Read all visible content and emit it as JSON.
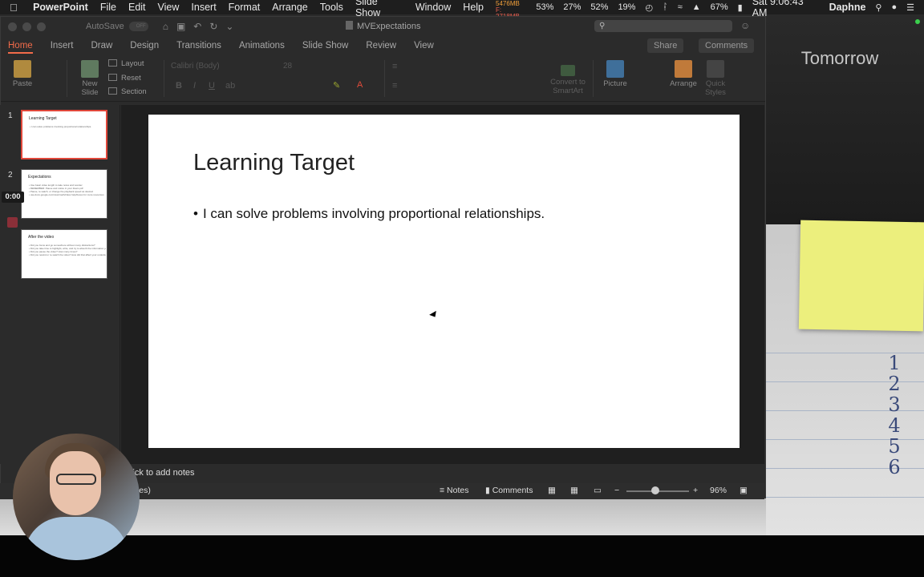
{
  "menubar": {
    "apple_icon": "apple-icon",
    "app_name": "PowerPoint",
    "items": [
      "File",
      "Edit",
      "View",
      "Insert",
      "Format",
      "Arrange",
      "Tools",
      "Slide Show",
      "Window",
      "Help"
    ],
    "memory_u": "U: 5476MB",
    "memory_f": "F: 2718MB",
    "stats": [
      "53%",
      "27%",
      "52%",
      "19%"
    ],
    "battery": "67%",
    "clock": "Sat 9:06:43 AM",
    "user": "Daphne"
  },
  "window": {
    "autosave_label": "AutoSave",
    "autosave_state": "OFF",
    "document_title": "MVExpectations"
  },
  "tabs": [
    "Home",
    "Insert",
    "Draw",
    "Design",
    "Transitions",
    "Animations",
    "Slide Show",
    "Review",
    "View"
  ],
  "share_label": "Share",
  "comments_label": "Comments",
  "ribbon": {
    "paste": "Paste",
    "new_slide_1": "New",
    "new_slide_2": "Slide",
    "layout": "Layout",
    "reset": "Reset",
    "section": "Section",
    "font_name": "Calibri (Body)",
    "font_size": "28",
    "convert_1": "Convert to",
    "convert_2": "SmartArt",
    "picture": "Picture",
    "arrange": "Arrange",
    "quick_styles_1": "Quick",
    "quick_styles_2": "Styles"
  },
  "thumbnails": [
    {
      "num": "1",
      "title": "Learning Target",
      "lines": [
        "• I can solve problems involving proportional relationships."
      ]
    },
    {
      "num": "2",
      "title": "Expectations",
      "lines": [
        "• Use basic video length to take notes and wonder",
        "• REMEMBER: Pause and notice in your Zeam pdf",
        "• Pause, re-watch, or change the playback speed as desired",
        "• use.docs.google.com/view/math/class help/boxes for more resources"
      ]
    },
    {
      "num": "3",
      "title": "After the video",
      "lines": [
        "• Did you focus and go somewhere without many distractions?",
        "• Did you take time to highlight, write, and try to absorb the information you heard?",
        "• Did you pause the video? How many times?",
        "• Did you rewind or re-watch the video? How did that affect your understanding of the learning target?"
      ]
    }
  ],
  "timer": "0:00",
  "slide": {
    "title": "Learning Target",
    "bullet": "I can solve problems involving proportional relationships."
  },
  "notes_placeholder": "lick to add notes",
  "status": {
    "slide_info_fragment": "ces)",
    "notes": "Notes",
    "comments": "Comments",
    "zoom": "96%"
  },
  "background": {
    "tomorrow": "Tomorrow",
    "hand_digits": [
      "1",
      "2",
      "3",
      "4",
      "5",
      "6"
    ]
  }
}
